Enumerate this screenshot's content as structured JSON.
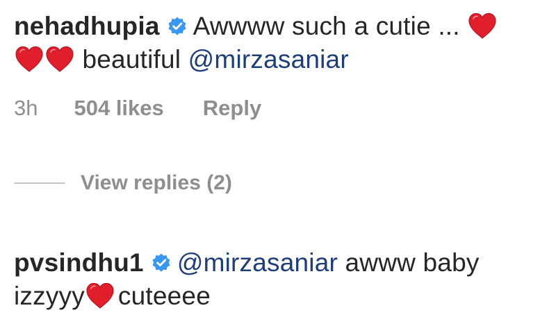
{
  "comments": [
    {
      "username": "nehadhupia",
      "verified": true,
      "text_start": "Awwww such a cutie ...",
      "text_end": "beautiful",
      "mention": "@mirzasaniar",
      "time": "3h",
      "likes": "504 likes",
      "reply_label": "Reply",
      "view_replies": "View replies (2)"
    },
    {
      "username": "pvsindhu1",
      "verified": true,
      "mention": "@mirzasaniar",
      "text_start": "awww baby",
      "text_middle": "izzyyy",
      "text_end": "cuteeee"
    }
  ],
  "icons": {
    "verified": "verified-badge-icon",
    "heart": "red-heart-emoji"
  },
  "colors": {
    "username": "#262626",
    "mention": "#1e3d7b",
    "meta": "#8e8e8e",
    "verified": "#3897f0",
    "heart": "#e01f2b"
  }
}
